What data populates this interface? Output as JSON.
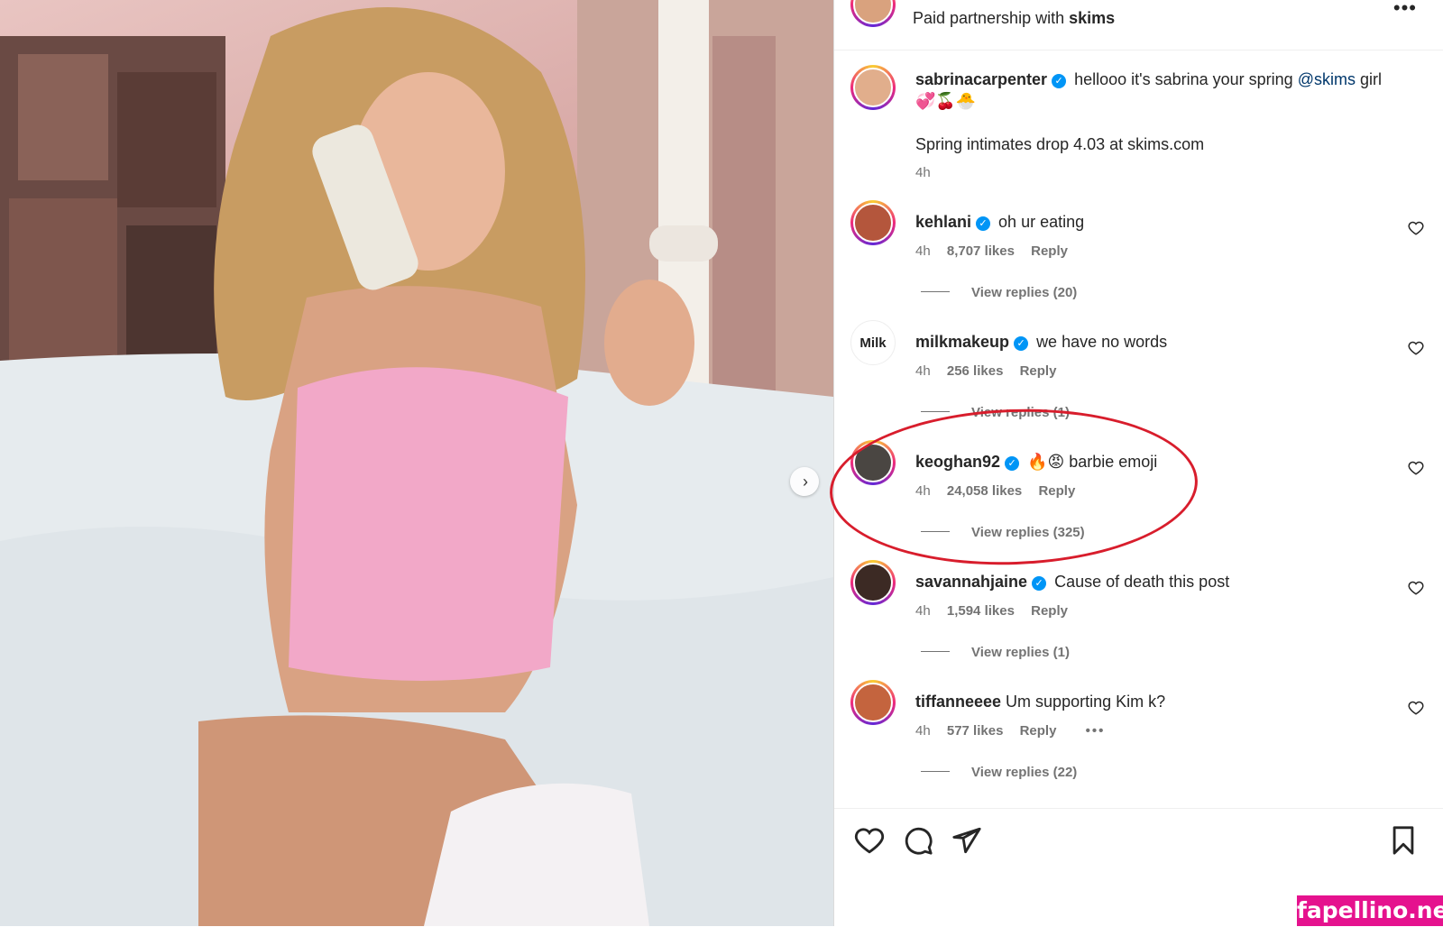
{
  "post": {
    "partnership_prefix": "Paid partnership with",
    "partner": "skims",
    "more_icon": "more-horizontal-icon"
  },
  "caption": {
    "username": "sabrinacarpenter",
    "text_before": "hellooo it's sabrina your spring",
    "mention": "@skims",
    "text_after": "girl 💞🍒🐣",
    "line2": "Spring intimates drop 4.03 at skims.com",
    "time": "4h"
  },
  "comments": [
    {
      "username": "kehlani",
      "verified": true,
      "text": "oh ur eating",
      "time": "4h",
      "likes": "8,707 likes",
      "reply": "Reply",
      "view_replies": "View replies (20)"
    },
    {
      "username": "milkmakeup",
      "verified": true,
      "text": "we have no words",
      "time": "4h",
      "likes": "256 likes",
      "reply": "Reply",
      "view_replies": "View replies (1)",
      "avatar_text": "Milk"
    },
    {
      "username": "keoghan92",
      "verified": true,
      "text": "🔥😡 barbie emoji",
      "time": "4h",
      "likes": "24,058 likes",
      "reply": "Reply",
      "view_replies": "View replies (325)"
    },
    {
      "username": "savannahjaine",
      "verified": true,
      "text": "Cause of death this post",
      "time": "4h",
      "likes": "1,594 likes",
      "reply": "Reply",
      "view_replies": "View replies (1)"
    },
    {
      "username": "tiffanneeee",
      "verified": false,
      "text": "Um supporting Kim k?",
      "time": "4h",
      "likes": "577 likes",
      "reply": "Reply",
      "view_replies": "View replies (22)",
      "more": "•••"
    }
  ],
  "actions": [
    "heart-icon",
    "comment-icon",
    "share-icon",
    "bookmark-icon"
  ],
  "watermark": "fapellino.net",
  "colors": {
    "verified": "#0095f6",
    "highlight_ring": "#d81d2c",
    "watermark_bg": "#e5128e",
    "mention": "#00376b"
  }
}
